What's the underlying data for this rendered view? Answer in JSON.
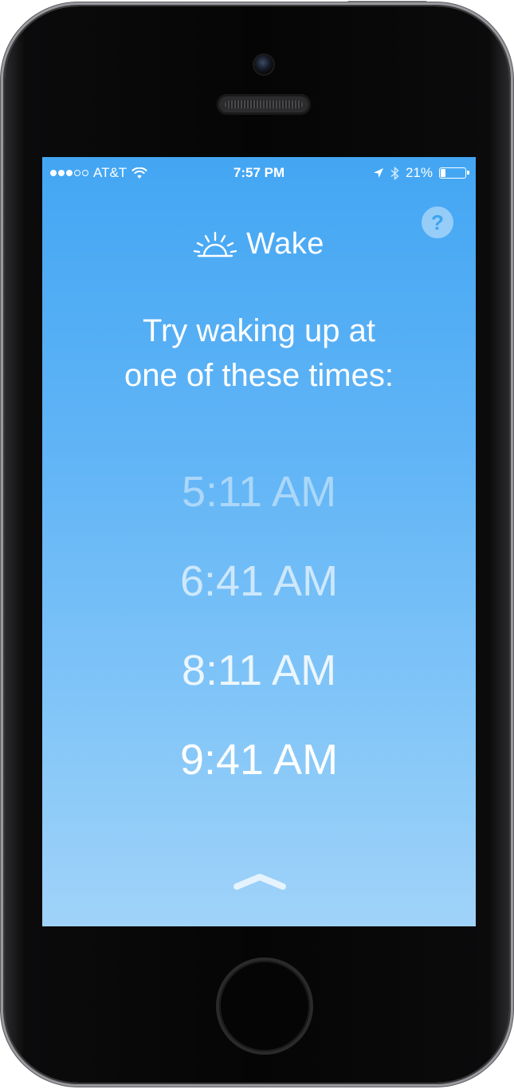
{
  "status_bar": {
    "signal_bars_filled": 3,
    "signal_bars_total": 5,
    "carrier": "AT&T",
    "time": "7:57 PM",
    "battery_percent": "21%",
    "battery_level": 0.21
  },
  "header": {
    "help_label": "?",
    "app_name": "Wake"
  },
  "main": {
    "headline_line1": "Try waking up at",
    "headline_line2": "one of these times:",
    "times": [
      {
        "label": "5:11 AM",
        "opacity": 0.45
      },
      {
        "label": "6:41 AM",
        "opacity": 0.65
      },
      {
        "label": "8:11 AM",
        "opacity": 0.85
      },
      {
        "label": "9:41 AM",
        "opacity": 1.0
      }
    ]
  },
  "colors": {
    "gradient_top": "#43a6f3",
    "gradient_bottom": "#a0d3f9",
    "text": "#ffffff",
    "phone_body": "#050505"
  },
  "icons": {
    "help": "question-mark-icon",
    "logo": "sunrise-icon",
    "swipe": "chevron-up-icon",
    "location": "location-arrow-icon",
    "bluetooth": "bluetooth-icon",
    "wifi": "wifi-icon",
    "battery": "battery-icon"
  }
}
